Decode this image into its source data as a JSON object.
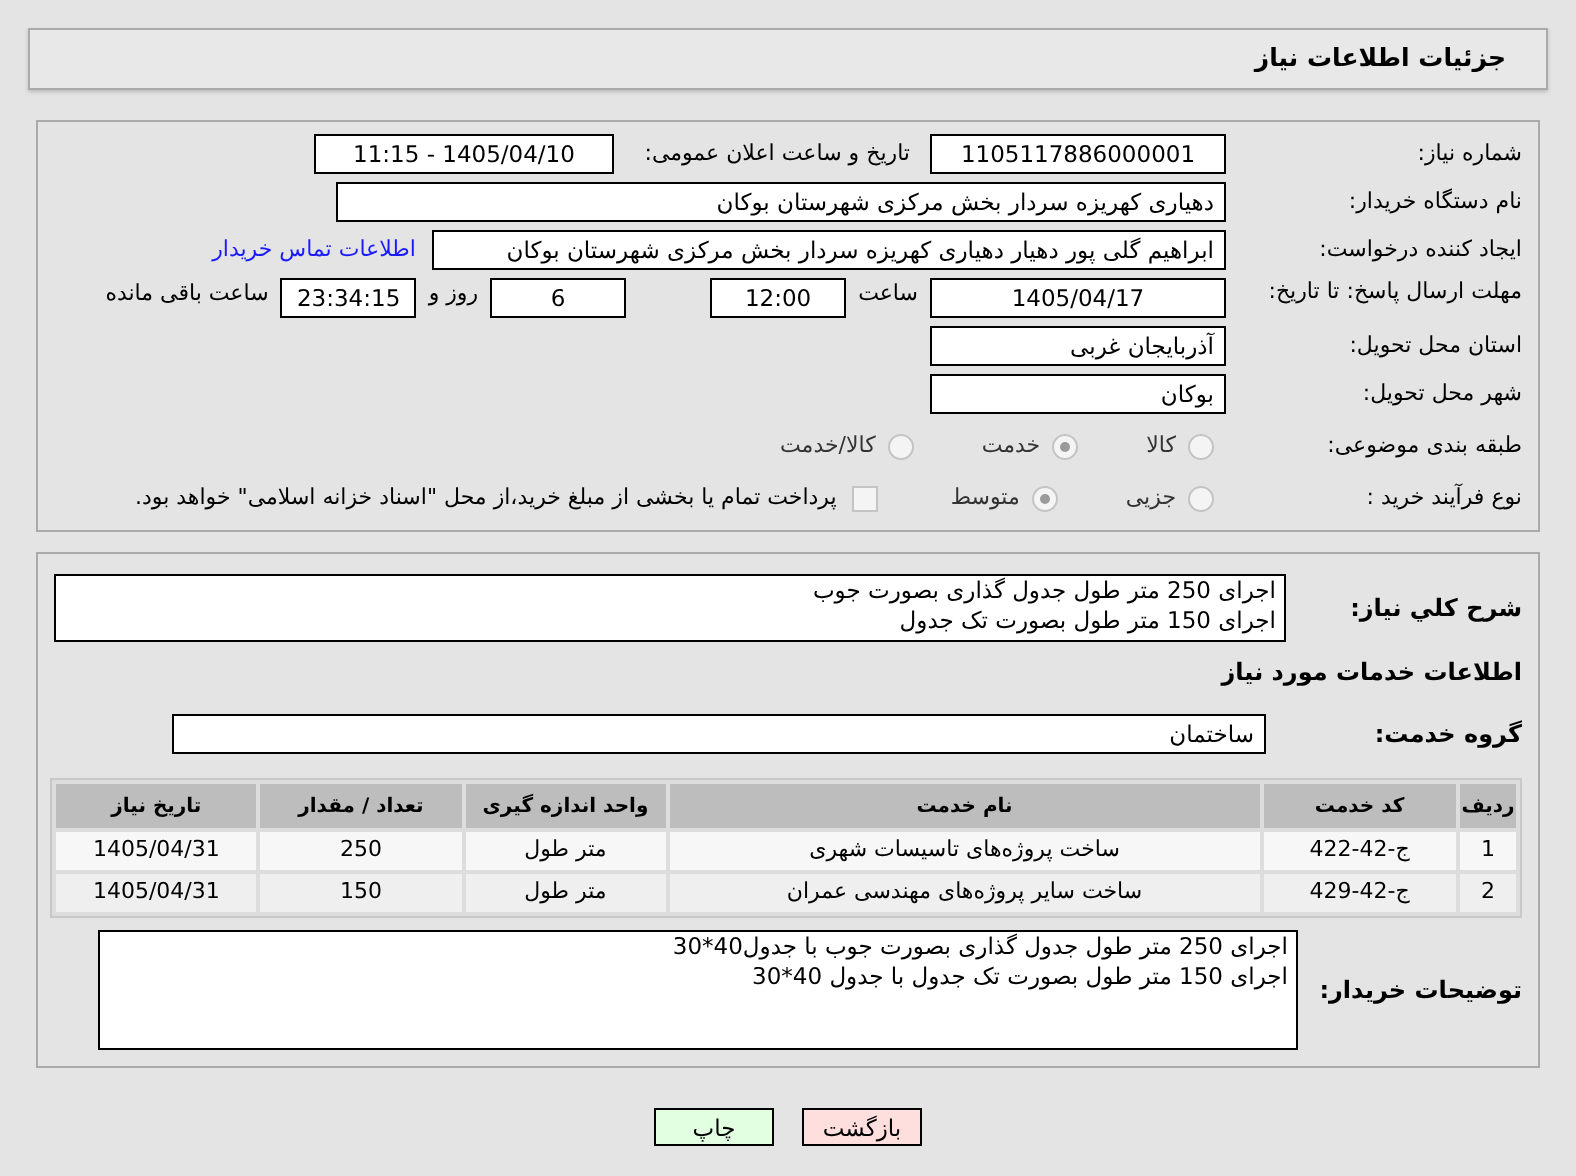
{
  "title": "جزئیات اطلاعات نیاز",
  "need_number": {
    "label": "شماره نیاز:",
    "value": "1105117886000001"
  },
  "announce": {
    "label": "تاریخ و ساعت اعلان عمومی:",
    "value": "1405/04/10 - 11:15"
  },
  "buyer_org": {
    "label": "نام دستگاه خریدار:",
    "value": "دهیاری کهریزه سردار بخش مرکزی شهرستان بوکان"
  },
  "requester": {
    "label": "ایجاد کننده درخواست:",
    "value": "ابراهیم گلی پور دهیار دهیاری کهریزه سردار بخش مرکزی شهرستان بوکان",
    "link": "اطلاعات تماس خریدار"
  },
  "deadline": {
    "label": "مهلت ارسال پاسخ: تا تاریخ:",
    "date": "1405/04/17",
    "time_label": "ساعت",
    "time": "12:00",
    "days": "6",
    "days_label": "روز و",
    "remaining": "23:34:15",
    "remaining_label": "ساعت باقی مانده"
  },
  "province": {
    "label": "استان محل تحویل:",
    "value": "آذربایجان غربی"
  },
  "city": {
    "label": "شهر محل تحویل:",
    "value": "بوکان"
  },
  "category": {
    "label": "طبقه بندی موضوعی:",
    "options": [
      {
        "label": "کالا",
        "selected": false
      },
      {
        "label": "خدمت",
        "selected": true
      },
      {
        "label": "کالا/خدمت",
        "selected": false
      }
    ]
  },
  "process": {
    "label": "نوع فرآیند خرید :",
    "options": [
      {
        "label": "جزیی",
        "selected": false
      },
      {
        "label": "متوسط",
        "selected": true
      }
    ],
    "payment": {
      "label": "پرداخت تمام یا بخشی از مبلغ خرید،از محل \"اسناد خزانه اسلامی\" خواهد بود.",
      "checked": false
    }
  },
  "description": {
    "label": "شرح کلي نياز:",
    "value": "اجرای 250 متر طول جدول گذاری بصورت جوب\nاجرای 150 متر طول بصورت تک جدول"
  },
  "services_title": "اطلاعات خدمات مورد نیاز",
  "service_group": {
    "label": "گروه خدمت:",
    "value": "ساختمان"
  },
  "table": {
    "columns": [
      "ردیف",
      "کد خدمت",
      "نام خدمت",
      "واحد اندازه گیری",
      "تعداد / مقدار",
      "تاریخ نیاز"
    ],
    "rows": [
      [
        "1",
        "ج-42-422",
        "ساخت پروژه‌های تاسیسات شهری",
        "متر طول",
        "250",
        "1405/04/31"
      ],
      [
        "2",
        "ج-42-429",
        "ساخت سایر پروژه‌های مهندسی عمران",
        "متر طول",
        "150",
        "1405/04/31"
      ]
    ]
  },
  "buyer_notes": {
    "label": "توضیحات خریدار:",
    "value": "اجرای 250 متر طول جدول گذاری بصورت جوب با جدول40*30\nاجرای 150 متر طول بصورت تک جدول با جدول 40*30"
  },
  "buttons": [
    {
      "label": "بازگشت",
      "kind": "back"
    },
    {
      "label": "چاپ",
      "kind": "print"
    }
  ]
}
